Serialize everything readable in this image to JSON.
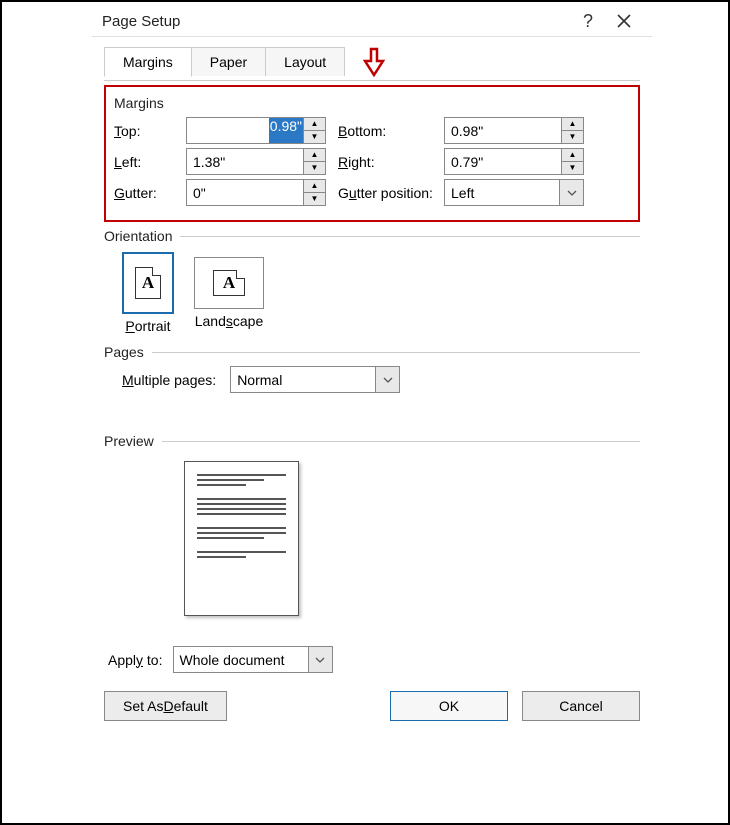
{
  "title": "Page Setup",
  "tabs": {
    "margins": "Margins",
    "paper": "Paper",
    "layout": "Layout"
  },
  "margins": {
    "section": "Margins",
    "top_label": "op:",
    "top_value": "0.98\"",
    "bottom_label": "ottom:",
    "bottom_value": "0.98\"",
    "left_label": "eft:",
    "left_value": "1.38\"",
    "right_label": "ight:",
    "right_value": "0.79\"",
    "gutter_label": "utter:",
    "gutter_value": "0\"",
    "gutterpos_label": "tter position:",
    "gutterpos_value": "Left"
  },
  "orientation": {
    "section": "Orientation",
    "portrait": "ortrait",
    "landscape": "cape"
  },
  "pages": {
    "section": "Pages",
    "multiple_label": "ultiple pages:",
    "multiple_value": "Normal"
  },
  "preview": {
    "section": "Preview"
  },
  "apply": {
    "label": "Appl",
    "label2": " to:",
    "value": "Whole document"
  },
  "buttons": {
    "default": "Set As ",
    "default2": "efault",
    "ok": "OK",
    "cancel": "Cancel"
  }
}
